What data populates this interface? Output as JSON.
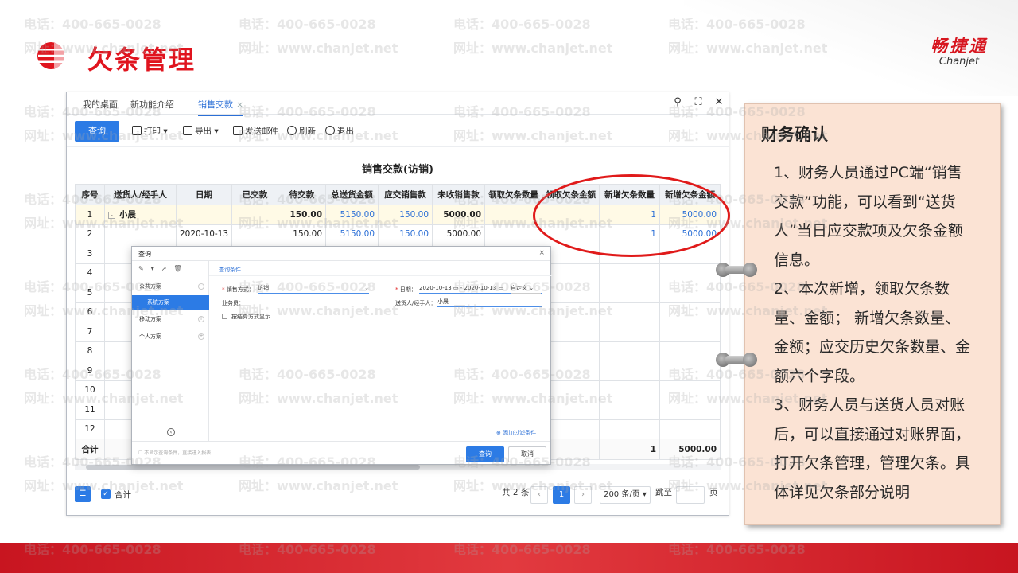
{
  "slide": {
    "title": "欠条管理",
    "brand_cn": "畅捷通",
    "brand_en": "Chanjet",
    "watermark_phone": "电话：400-665-0028",
    "watermark_site": "网址：www.chanjet.net",
    "accent_color": "#e0141e"
  },
  "window": {
    "tabs": [
      {
        "label": "我的桌面"
      },
      {
        "label": "新功能介绍"
      },
      {
        "label": "销售交款",
        "active": true
      }
    ],
    "tab_close": "×",
    "controls": {
      "search": "⚲",
      "expand": "⛶",
      "close": "✕"
    }
  },
  "toolbar": {
    "query": "查询",
    "print": "打印",
    "export": "导出",
    "send_mail": "发送邮件",
    "refresh": "刷新",
    "exit": "退出"
  },
  "report": {
    "title": "销售交款(访销)",
    "columns": [
      "序号",
      "送货人/经手人",
      "日期",
      "已交款",
      "待交款",
      "总送货金额",
      "应交销售款",
      "未收销售款",
      "领取欠条数量",
      "领取欠条金额",
      "新增欠条数量",
      "新增欠条金额"
    ],
    "rows": [
      {
        "no": "1",
        "person": "小晨",
        "date": "",
        "paid": "",
        "pending": "150.00",
        "total": "5150.00",
        "due": "150.00",
        "unpaid": "5000.00",
        "recv_qty": "",
        "recv_amt": "",
        "new_qty": "1",
        "new_amt": "5000.00"
      },
      {
        "no": "2",
        "person": "",
        "date": "2020-10-13",
        "paid": "",
        "pending": "150.00",
        "total": "5150.00",
        "due": "150.00",
        "unpaid": "5000.00",
        "recv_qty": "",
        "recv_amt": "",
        "new_qty": "1",
        "new_amt": "5000.00"
      }
    ],
    "empty_rows": [
      "3",
      "4",
      "5",
      "6",
      "7",
      "8",
      "9",
      "10",
      "11",
      "12"
    ],
    "total_label": "合计",
    "total_new_qty": "1",
    "total_new_amt": "5000.00",
    "expand_glyph": "-"
  },
  "footer": {
    "columns_icon": "☰",
    "sum_checkbox_label": "合计",
    "record_count": "共 2 条",
    "prev": "‹",
    "current_page": "1",
    "next": "›",
    "page_size": "200 条/页",
    "goto_label": "跳至",
    "page_unit": "页"
  },
  "dialog": {
    "title": "查询",
    "close": "×",
    "side_icons": "✎▾↗🗑",
    "schemes": {
      "public": "公共方案",
      "system": "系统方案",
      "mobile": "移动方案",
      "personal": "个人方案"
    },
    "tab": "查询条件",
    "sale_method_label": "销售方式：",
    "sale_method_value": "访销",
    "salesman_label": "业务员：",
    "by_settle_label": "按结算方式显示",
    "date_label": "日期：",
    "date_from": "2020-10-13",
    "date_to": "2020-10-13",
    "date_range_sep": "-",
    "date_custom": "自定义",
    "deliverer_label": "送货人/经手人：",
    "deliverer_value": "小晨",
    "add_filter": "添加过滤条件",
    "footer_note": "不显示查询条件，直接进入报表",
    "ok": "查询",
    "cancel": "取消"
  },
  "note": {
    "heading": "财务确认",
    "paragraphs": [
      "1、财务人员通过PC端“销售交款”功能，可以看到“送货人”当日应交款项及欠条金额信息。",
      "2、本次新增，领取欠条数量、金额； 新增欠条数量、金额；应交历史欠条数量、金额六个字段。",
      "3、财务人员与送货人员对账后，可以直接通过对账界面，打开欠条管理，管理欠条。具体详见欠条部分说明"
    ]
  }
}
